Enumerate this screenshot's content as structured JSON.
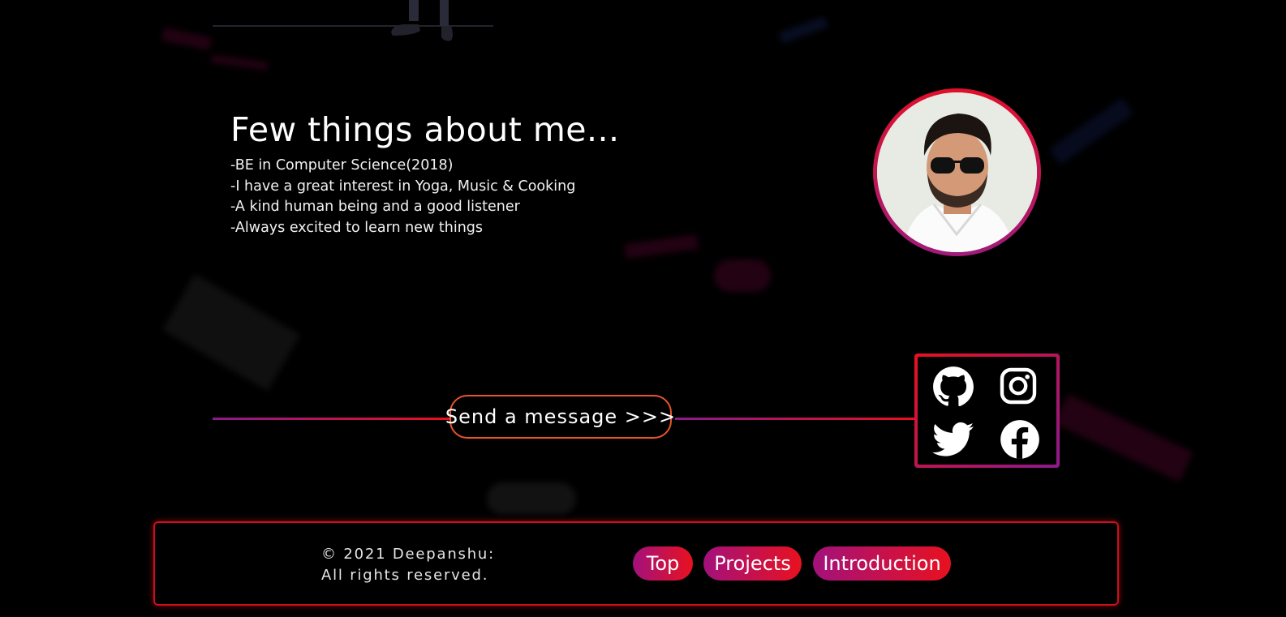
{
  "about": {
    "title": "Few things about me...",
    "items": [
      "-BE in Computer Science(2018)",
      "-I have a great interest in Yoga, Music & Cooking",
      "-A kind human being and a good listener",
      "-Always excited to learn new things"
    ]
  },
  "contact": {
    "send_label": "Send a message >>>"
  },
  "social": {
    "icons": [
      "github-icon",
      "instagram-icon",
      "twitter-icon",
      "facebook-icon"
    ]
  },
  "footer": {
    "copyright_line1": "© 2021 Deepanshu:",
    "copyright_line2": "All rights reserved.",
    "nav": [
      "Top",
      "Projects",
      "Introduction"
    ]
  },
  "colors": {
    "accent_red": "#e8111f",
    "accent_purple": "#8b1a8c",
    "background": "#000000"
  }
}
